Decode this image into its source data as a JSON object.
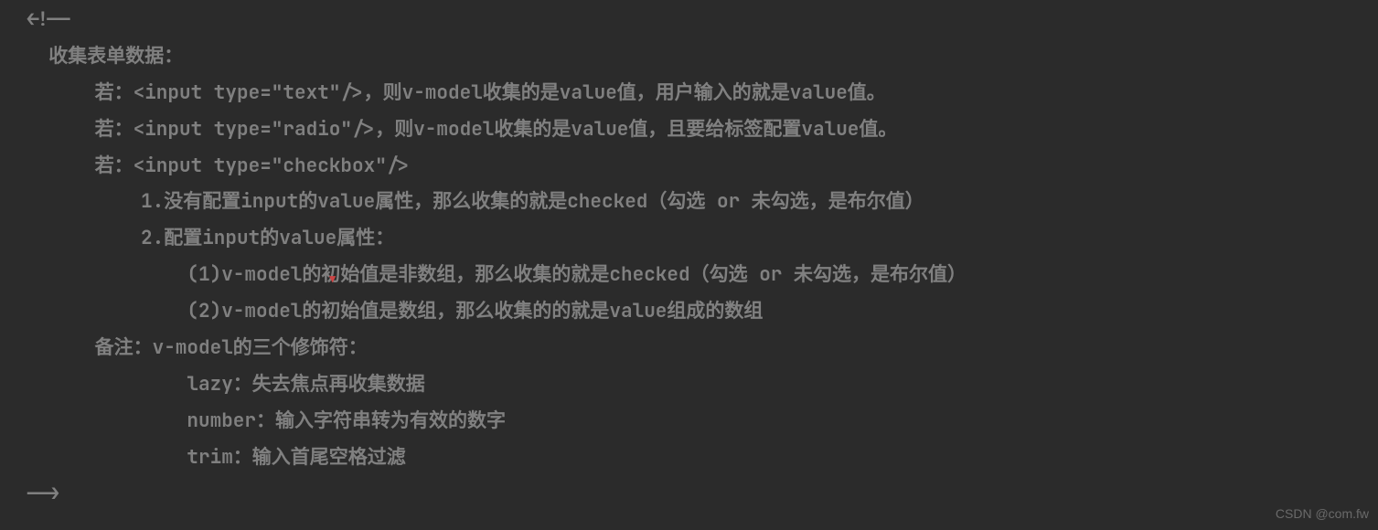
{
  "lines": {
    "l1": "<!--",
    "l2": "  收集表单数据：",
    "l3": "      若：<input type=\"text\"/>，则v-model收集的是value值，用户输入的就是value值。",
    "l4": "      若：<input type=\"radio\"/>，则v-model收集的是value值，且要给标签配置value值。",
    "l5": "      若：<input type=\"checkbox\"/>",
    "l6": "          1.没有配置input的value属性，那么收集的就是checked（勾选 or 未勾选，是布尔值）",
    "l7": "          2.配置input的value属性：",
    "l8": "              (1)v-model的初始值是非数组，那么收集的就是checked（勾选 or 未勾选，是布尔值）",
    "l9": "              (2)v-model的初始值是数组，那么收集的的就是value组成的数组",
    "l10": "      备注：v-model的三个修饰符：",
    "l11": "              lazy：失去焦点再收集数据",
    "l12": "              number：输入字符串转为有效的数字",
    "l13": "              trim：输入首尾空格过滤",
    "l14": "-->"
  },
  "watermark": "CSDN @com.fw"
}
